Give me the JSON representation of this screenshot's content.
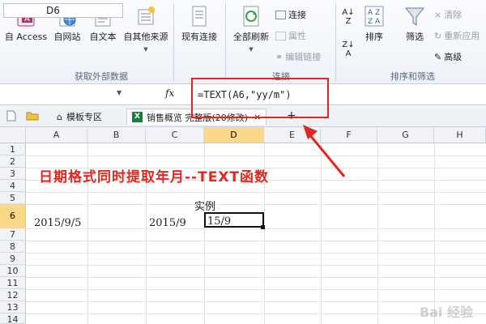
{
  "ribbon": {
    "get_external": {
      "buttons": [
        {
          "label": "自 Access",
          "icon": "access-db-icon"
        },
        {
          "label": "自网站",
          "icon": "globe-icon"
        },
        {
          "label": "自文本",
          "icon": "text-file-icon"
        },
        {
          "label": "自其他来源",
          "icon": "other-source-icon"
        }
      ],
      "group_label": "获取外部数据"
    },
    "existing_conn_label": "现有连接",
    "connections": {
      "refresh_label": "全部刷新",
      "items": [
        "连接",
        "属性",
        "编辑链接"
      ],
      "group_label": "连接"
    },
    "sort_filter": {
      "sort_label": "排序",
      "filter_label": "筛选",
      "items": [
        "清除",
        "重新应用",
        "高级"
      ],
      "group_label": "排序和筛选"
    }
  },
  "formula_bar": {
    "name_box": "D6",
    "fx_label": "fx",
    "formula": "=TEXT(A6,\"yy/m\")"
  },
  "tab_strip": {
    "tabs": [
      {
        "label": "模板专区",
        "active": false
      },
      {
        "label": "销售概览 完整版(20修改)",
        "active": true
      }
    ],
    "close_label": "×",
    "add_label": "+"
  },
  "grid": {
    "columns": [
      "A",
      "B",
      "C",
      "D",
      "E",
      "F",
      "G",
      "H"
    ],
    "rows": [
      "1",
      "2",
      "3",
      "4",
      "5",
      "6",
      "7",
      "8",
      "9",
      "10",
      "11",
      "12",
      "13",
      "14",
      "15"
    ],
    "selected_column": "D",
    "selected_row": "6",
    "cells": {
      "D5": "实例",
      "A6": "2015/9/5",
      "C6": "2015/9",
      "D6": "15/9"
    }
  },
  "annotation": {
    "headline": "日期格式同时提取年月--TEXT函数",
    "color": "#e0281f"
  },
  "watermark": "Bai 经验"
}
